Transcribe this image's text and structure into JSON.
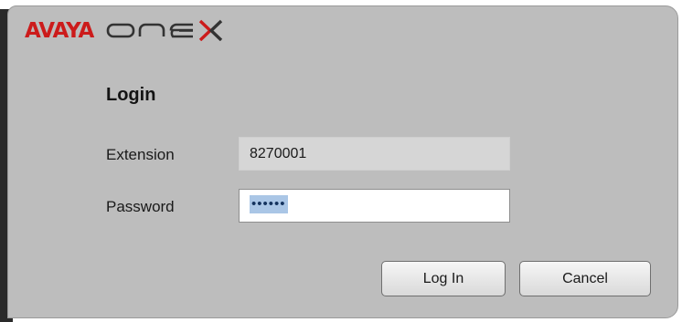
{
  "brand": {
    "name_primary": "AVAYA",
    "name_secondary": "one-X"
  },
  "login": {
    "title": "Login",
    "extension_label": "Extension",
    "extension_value": "8270001",
    "password_label": "Password",
    "password_value": "••••••"
  },
  "buttons": {
    "login_label": "Log In",
    "cancel_label": "Cancel"
  },
  "colors": {
    "brand_red": "#cc1b1b",
    "dialog_bg": "#bdbdbd",
    "selection": "#aac6e6"
  }
}
